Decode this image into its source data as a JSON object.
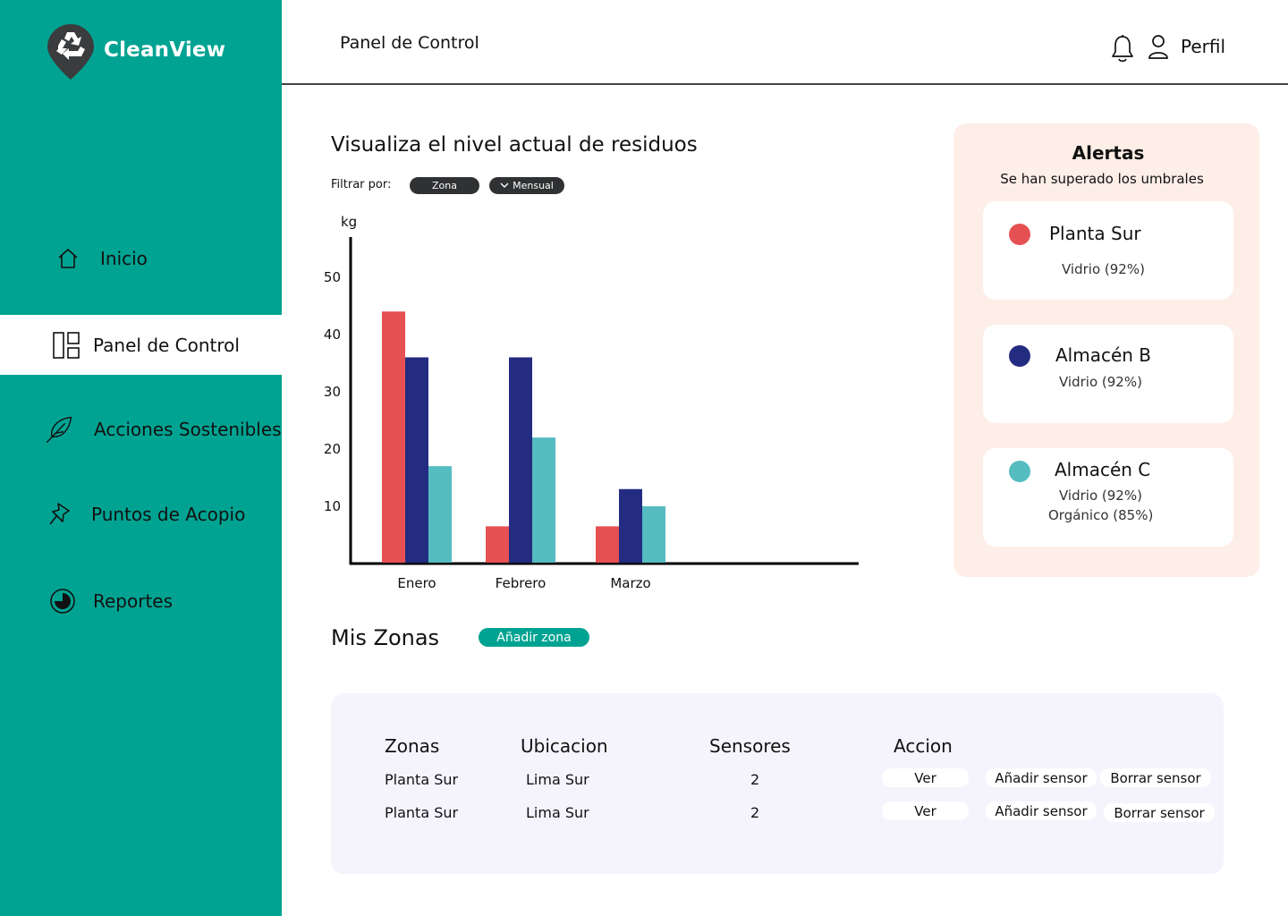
{
  "app": {
    "name": "CleanView"
  },
  "colors": {
    "primary": "#00a392",
    "series_red": "#e55052",
    "series_navy": "#232c81",
    "series_teal": "#55bcc0",
    "alerts_bg": "#fdeee7",
    "table_bg": "#f5f4fd"
  },
  "sidebar": {
    "items": [
      {
        "label": "Inicio",
        "icon": "home-icon"
      },
      {
        "label": "Panel de Control",
        "icon": "dashboard-icon",
        "active": true
      },
      {
        "label": "Acciones Sostenibles",
        "icon": "feather-icon"
      },
      {
        "label": "Puntos de Acopio",
        "icon": "pin-icon"
      },
      {
        "label": "Reportes",
        "icon": "pie-icon"
      }
    ]
  },
  "header": {
    "title": "Panel de Control",
    "profile_label": "Perfil"
  },
  "chart_section": {
    "title": "Visualiza el nivel actual de residuos",
    "filter_label": "Filtrar por:",
    "filters": [
      "Zona",
      "Mensual"
    ]
  },
  "chart_data": {
    "type": "bar",
    "ylabel": "kg",
    "yticks": [
      10,
      20,
      30,
      40,
      50
    ],
    "ylim": [
      0,
      57
    ],
    "categories": [
      "Enero",
      "Febrero",
      "Marzo"
    ],
    "series": [
      {
        "values": [
          44,
          6.5,
          6.5
        ],
        "color": "#e55052"
      },
      {
        "values": [
          36,
          36,
          13
        ],
        "color": "#232c81"
      },
      {
        "values": [
          17,
          22,
          10
        ],
        "color": "#55bcc0"
      }
    ],
    "grid": false,
    "legend": "none"
  },
  "alerts": {
    "title": "Alertas",
    "subtitle": "Se han superado los umbrales",
    "items": [
      {
        "name": "Planta Sur",
        "details": [
          "Vidrio (92%)"
        ],
        "color": "#e55052"
      },
      {
        "name": "Almacén B",
        "details": [
          "Vidrio (92%)"
        ],
        "color": "#232c81"
      },
      {
        "name": "Almacén C",
        "details": [
          "Vidrio (92%)",
          "Orgánico (85%)"
        ],
        "color": "#55bcc0"
      }
    ]
  },
  "zones": {
    "title": "Mis Zonas",
    "add_label": "Añadir zona",
    "columns": [
      "Zonas",
      "Ubicacion",
      "Sensores",
      "Accion"
    ],
    "rows": [
      {
        "zona": "Planta Sur",
        "ubicacion": "Lima Sur",
        "sensores": "2"
      },
      {
        "zona": "Planta Sur",
        "ubicacion": "Lima Sur",
        "sensores": "2"
      }
    ],
    "actions": {
      "view": "Ver",
      "add_sensor": "Añadir sensor",
      "delete_sensor": "Borrar sensor"
    }
  }
}
